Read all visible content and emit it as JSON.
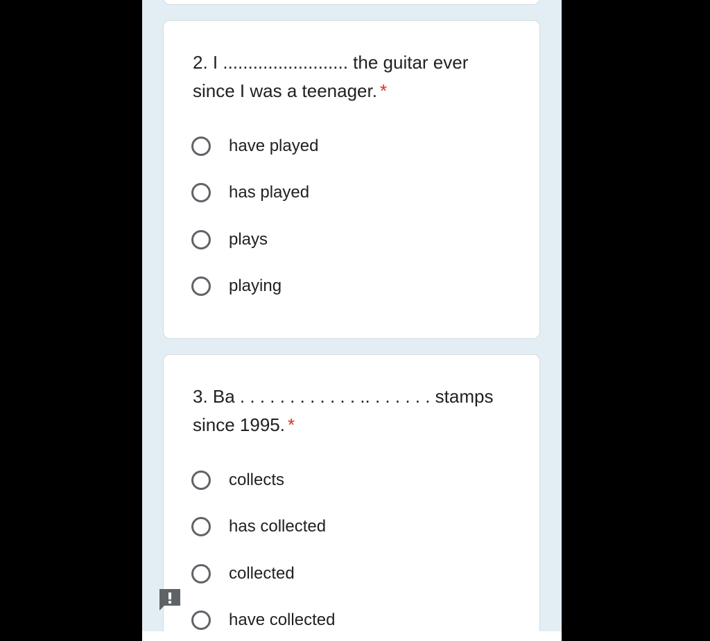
{
  "questions": [
    {
      "id": "q2",
      "text": "2. I ......................... the guitar ever since I was a teenager.",
      "required_mark": "*",
      "options": [
        "have played",
        "has played",
        "plays",
        "playing"
      ]
    },
    {
      "id": "q3",
      "text": "3. Ba . . . . . . . . . . . . .. . . . . . . stamps since 1995.",
      "required_mark": "*",
      "options": [
        "collects",
        "has collected",
        "collected",
        "have collected"
      ]
    }
  ],
  "colors": {
    "page_background": "#e3edf4",
    "card_background": "#ffffff",
    "required_star": "#d93025",
    "radio_border": "#5f6368",
    "feedback_icon": "#5f6368"
  },
  "icons": {
    "feedback": "report-feedback-icon"
  }
}
